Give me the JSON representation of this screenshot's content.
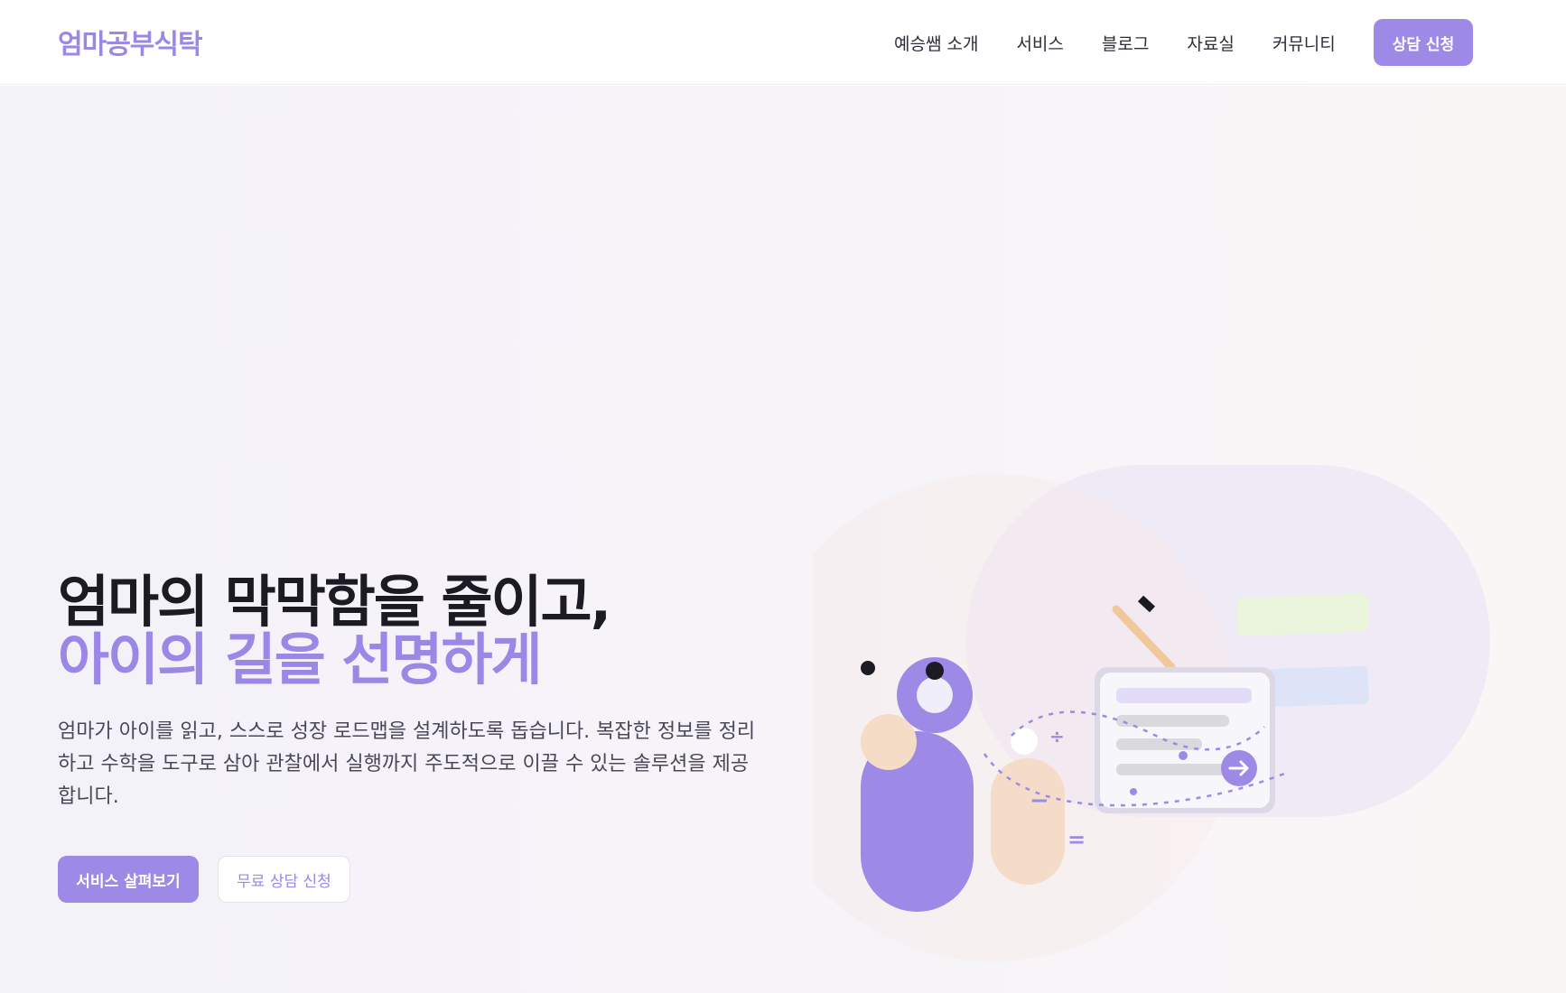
{
  "header": {
    "logo": "엄마공부식탁",
    "nav": [
      "예승쌤 소개",
      "서비스",
      "블로그",
      "자료실",
      "커뮤니티"
    ],
    "cta": "상담 신청"
  },
  "hero": {
    "title_line1": "엄마의 막막함을 줄이고,",
    "title_line2": "아이의 길을 선명하게",
    "description": "엄마가 아이를 읽고, 스스로 성장 로드맵을 설계하도록 돕습니다. 복잡한 정보를 정리하고 수학을 도구로 삼아 관찰에서 실행까지 주도적으로 이끌 수 있는 솔루션을 제공합니다.",
    "primary_button": "서비스 살펴보기",
    "secondary_button": "무료 상담 신청"
  },
  "illustration": {
    "symbols": [
      "÷",
      "−",
      "="
    ],
    "icons": [
      "arrow-right-icon",
      "pencil-icon"
    ]
  },
  "colors": {
    "accent": "#9d8ae6",
    "peach": "#f5dcc8",
    "dark": "#1c1b24"
  }
}
